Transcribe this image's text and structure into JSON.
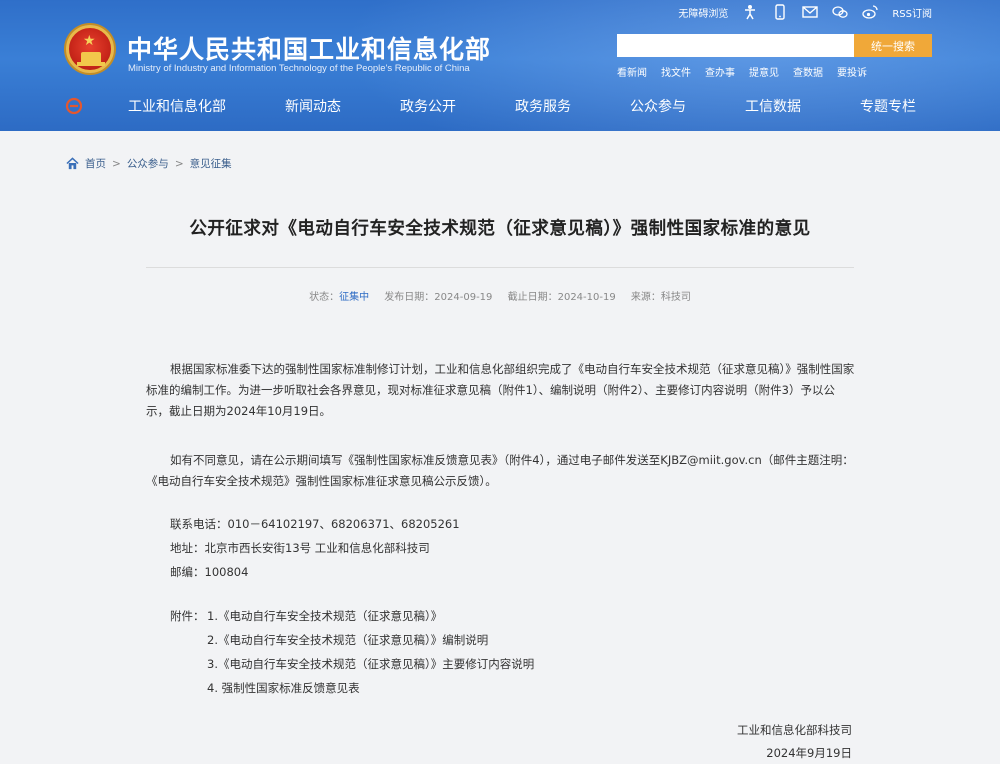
{
  "header": {
    "title": "中华人民共和国工业和信息化部",
    "subtitle": "Ministry of Industry and Information Technology of the People's Republic of China",
    "tools": {
      "accessibility": "无障碍浏览",
      "rss": "RSS订阅"
    },
    "search": {
      "placeholder": "",
      "button": "统一搜索"
    },
    "quick_links": [
      "看新闻",
      "找文件",
      "查办事",
      "提意见",
      "查数据",
      "要投诉"
    ],
    "nav": [
      "工业和信息化部",
      "新闻动态",
      "政务公开",
      "政务服务",
      "公众参与",
      "工信数据",
      "专题专栏"
    ]
  },
  "breadcrumb": {
    "home": "首页",
    "sep": ">",
    "level1": "公众参与",
    "level2": "意见征集"
  },
  "article": {
    "title": "公开征求对《电动自行车安全技术规范（征求意见稿）》强制性国家标准的意见",
    "meta": {
      "status_label": "状态：",
      "status_value": "征集中",
      "publish_label": "发布日期：",
      "publish_date": "2024-09-19",
      "deadline_label": "截止日期：",
      "deadline_date": "2024-10-19",
      "source_label": "来源：",
      "source_value": "科技司"
    },
    "paragraph1": "根据国家标准委下达的强制性国家标准制修订计划，工业和信息化部组织完成了《电动自行车安全技术规范（征求意见稿）》强制性国家标准的编制工作。为进一步听取社会各界意见，现对标准征求意见稿（附件1）、编制说明（附件2）、主要修订内容说明（附件3）予以公示，截止日期为2024年10月19日。",
    "paragraph2": "如有不同意见，请在公示期间填写《强制性国家标准反馈意见表》（附件4），通过电子邮件发送至KJBZ@miit.gov.cn（邮件主题注明：《电动自行车安全技术规范》强制性国家标准征求意见稿公示反馈）。",
    "contact": {
      "phone": "联系电话：010－64102197、68206371、68205261",
      "address": "地址：北京市西长安街13号 工业和信息化部科技司",
      "postcode": "邮编：100804"
    },
    "attachments_label": "附件：",
    "attachments": [
      "1.《电动自行车安全技术规范（征求意见稿）》",
      "2.《电动自行车安全技术规范（征求意见稿）》编制说明",
      "3.《电动自行车安全技术规范（征求意见稿）》主要修订内容说明",
      "4. 强制性国家标准反馈意见表"
    ],
    "signature": {
      "org": "工业和信息化部科技司",
      "date": "2024年9月19日"
    }
  },
  "colors": {
    "header_blue": "#2f6fc9",
    "search_button": "#f0a839",
    "link_blue": "#2d6bc4"
  }
}
